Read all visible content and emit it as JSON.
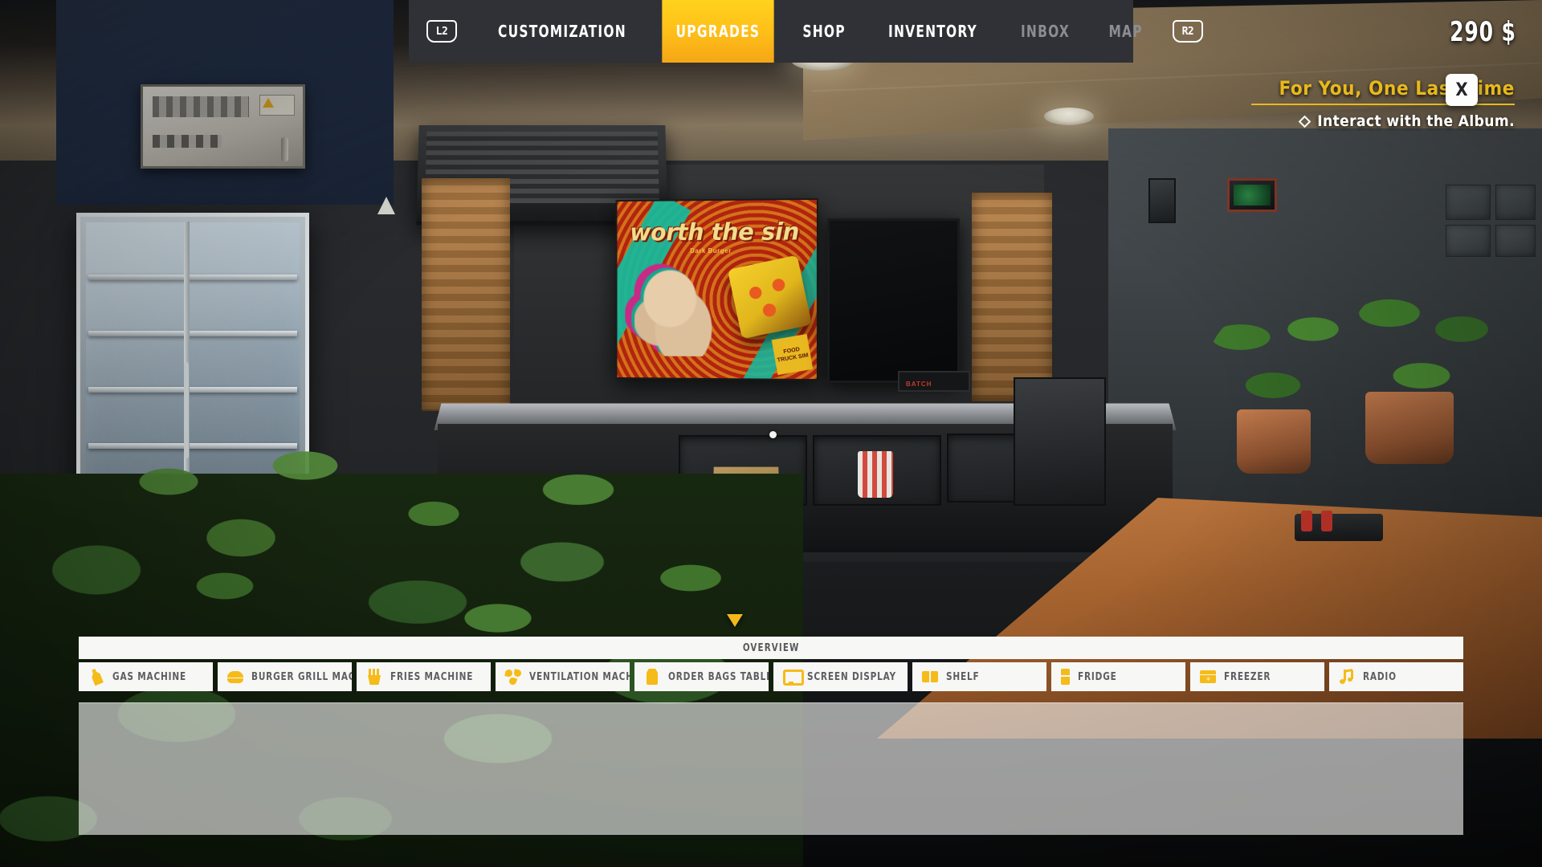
{
  "topnav": {
    "left_button": "L2",
    "right_button": "R2",
    "items": [
      {
        "label": "CUSTOMIZATION",
        "state": "normal"
      },
      {
        "label": "UPGRADES",
        "state": "active"
      },
      {
        "label": "SHOP",
        "state": "normal"
      },
      {
        "label": "INVENTORY",
        "state": "normal"
      },
      {
        "label": "INBOX",
        "state": "dim"
      },
      {
        "label": "MAP",
        "state": "dim"
      }
    ]
  },
  "hud": {
    "money": "290 $",
    "accent_yellow": "#ffc019",
    "quest_yellow": "#e8b91c",
    "nav_bg": "#2f3136",
    "panel_white": "#f7f7f5"
  },
  "quest": {
    "close_label": "X",
    "title": "For You, One Last Time",
    "objective": "Interact with the Album."
  },
  "bottom": {
    "overview_label": "OVERVIEW",
    "tabs": [
      {
        "label": "GAS MACHINE",
        "icon": "gas-bottle-icon",
        "icon_class": "ic-bottle"
      },
      {
        "label": "BURGER GRILL MACHINE",
        "icon": "burger-icon",
        "icon_class": "ic-burger"
      },
      {
        "label": "FRIES MACHINE",
        "icon": "fries-icon",
        "icon_class": "ic-fries"
      },
      {
        "label": "VENTILATION MACHINE",
        "icon": "fan-icon",
        "icon_class": "ic-fan"
      },
      {
        "label": "ORDER BAGS TABLE",
        "icon": "paper-bag-icon",
        "icon_class": "ic-bag"
      },
      {
        "label": "SCREEN DISPLAY",
        "icon": "monitor-icon",
        "icon_class": "ic-screen"
      },
      {
        "label": "SHELF",
        "icon": "shelf-icon",
        "icon_class": "ic-shelf"
      },
      {
        "label": "FRIDGE",
        "icon": "fridge-icon",
        "icon_class": "ic-fridge2"
      },
      {
        "label": "FREEZER",
        "icon": "freezer-icon",
        "icon_class": "ic-freezer"
      },
      {
        "label": "RADIO",
        "icon": "music-note-icon",
        "icon_class": "ic-note"
      }
    ]
  },
  "scene": {
    "poster_title": "worth the sin",
    "poster_subtitle": "Dark Burger",
    "poster_logo": "FOOD TRUCK SIM"
  }
}
